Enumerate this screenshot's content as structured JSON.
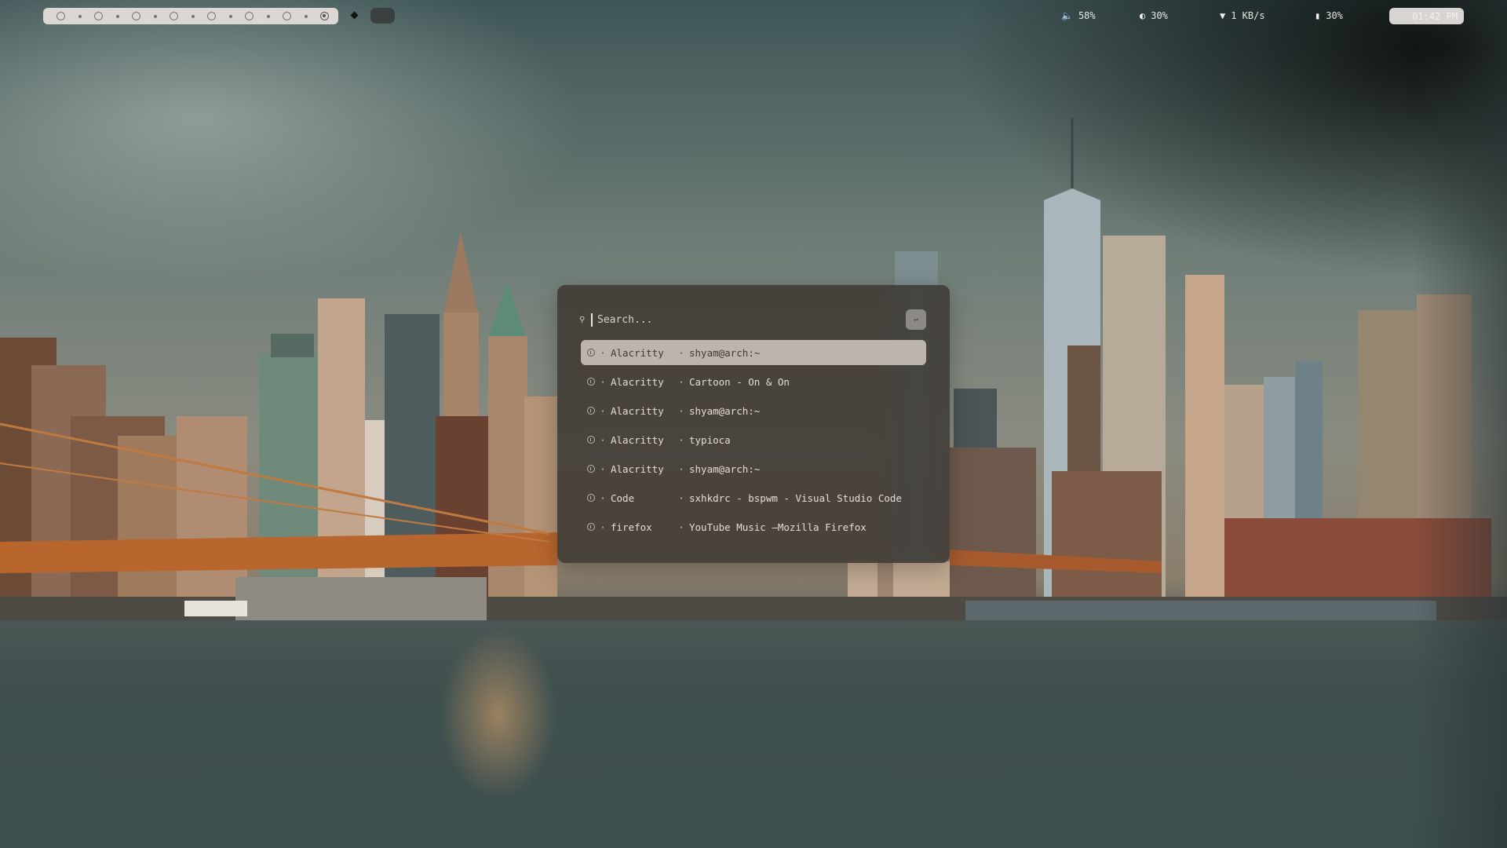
{
  "workspaces": {
    "count": 8,
    "active_index": 7
  },
  "status_bar": {
    "volume": {
      "icon": "volume-icon",
      "value": "58%"
    },
    "brightness": {
      "icon": "brightness-icon",
      "value": "30%"
    },
    "network": {
      "icon": "wifi-icon",
      "value": "1 KB/s"
    },
    "battery": {
      "icon": "battery-icon",
      "value": "30%"
    },
    "clock": "01:42 PM"
  },
  "launcher": {
    "search_placeholder": "Search...",
    "mode_button_icon": "enter-icon",
    "results": [
      {
        "app": "Alacritty",
        "title": "shyam@arch:~",
        "selected": true
      },
      {
        "app": "Alacritty",
        "title": "Cartoon - On & On",
        "selected": false
      },
      {
        "app": "Alacritty",
        "title": "shyam@arch:~",
        "selected": false
      },
      {
        "app": "Alacritty",
        "title": "typioca",
        "selected": false
      },
      {
        "app": "Alacritty",
        "title": "shyam@arch:~",
        "selected": false
      },
      {
        "app": "Code",
        "title": "sxhkdrc - bspwm - Visual Studio Code",
        "selected": false
      },
      {
        "app": "firefox",
        "title": "YouTube Music —Mozilla Firefox",
        "selected": false
      }
    ],
    "separator": "·"
  },
  "wallpaper": {
    "description_icon": "city-skyline-wallpaper"
  }
}
